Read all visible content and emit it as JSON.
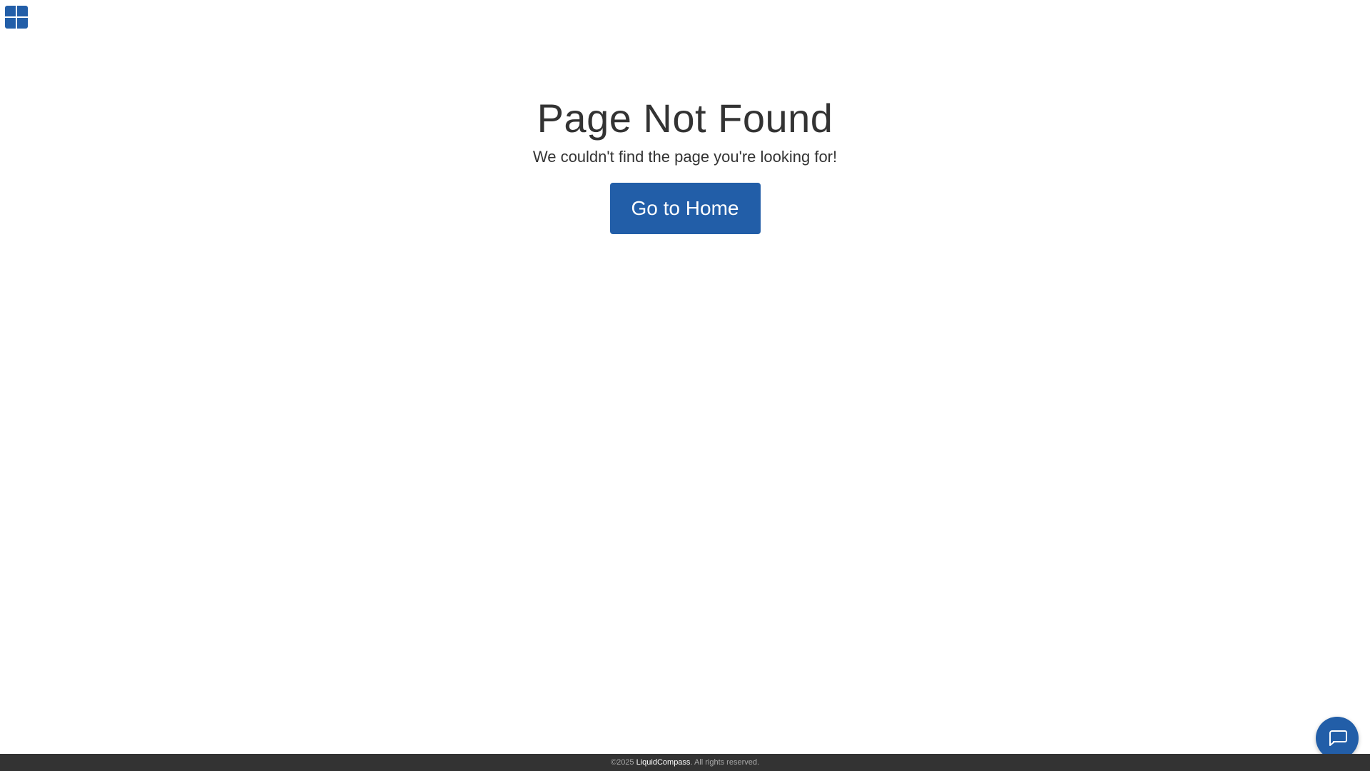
{
  "header": {
    "logo_icon": "windows-grid-logo-icon",
    "logo_color": "#225ea8"
  },
  "main": {
    "title": "Page Not Found",
    "subtitle": "We couldn't find the page you're looking for!",
    "home_button_label": "Go to Home",
    "button_color": "#225ea8"
  },
  "footer": {
    "copyright": "©2025",
    "brand": "LiquidCompass",
    "rights": ". All rights reserved.",
    "background": "#333333"
  },
  "chat": {
    "icon": "chat-bubble-icon",
    "color": "#225ea8"
  }
}
